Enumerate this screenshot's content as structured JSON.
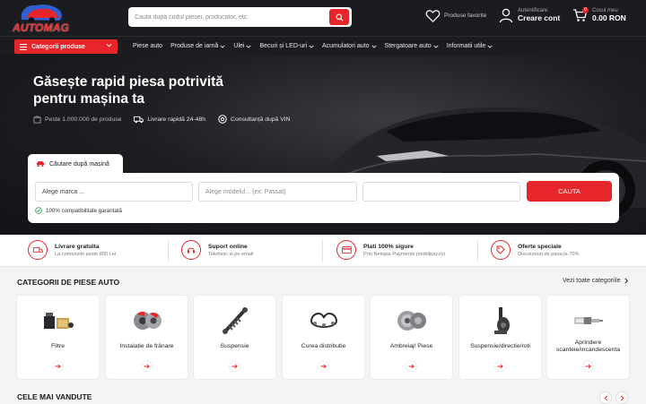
{
  "header": {
    "logo_text": "AUTOMAG",
    "search_placeholder": "Cauta dupa codul piesei, producator, etc.",
    "favorites_label": "Produse favorite",
    "account_small": "Autentificare",
    "account_big": "Creare cont",
    "cart_small": "Cosul meu",
    "cart_total": "0.00 RON",
    "cart_count": "0"
  },
  "nav": {
    "categories_button": "Categorii produse",
    "items": [
      {
        "label": "Piese auto",
        "dropdown": false
      },
      {
        "label": "Produse de iarnă",
        "dropdown": true
      },
      {
        "label": "Ulei",
        "dropdown": true
      },
      {
        "label": "Becuri și LED-uri",
        "dropdown": true
      },
      {
        "label": "Acumulatori auto",
        "dropdown": true
      },
      {
        "label": "Stergatoare auto",
        "dropdown": true
      },
      {
        "label": "Informatii utile",
        "dropdown": true
      }
    ]
  },
  "hero": {
    "title": "Găsește rapid piesa potrivită pentru mașina ta",
    "features": [
      "Peste 1.000.000 de produse",
      "Livrare rapidă 24-48h",
      "Consultanță după VIN"
    ]
  },
  "car_search": {
    "tab_label": "Căutare după mașină",
    "brand_placeholder": "Alege marca ...",
    "model_placeholder": "Alege modelul... (ex: Passat)",
    "third_value": "",
    "submit_label": "CAUTA",
    "compat_text": "100% compatibilitate garantată"
  },
  "perks": [
    {
      "title": "Livrare gratuita",
      "sub": "La comenzile peste 800 Lei",
      "icon": "truck-icon"
    },
    {
      "title": "Suport online",
      "sub": "Telefonic si pe email",
      "icon": "headset-icon"
    },
    {
      "title": "Plati 100% sigure",
      "sub": "Prin Netopia Payments (mobilpay.ro)",
      "icon": "card-icon"
    },
    {
      "title": "Oferte speciale",
      "sub": "Discounturi de pana la 70%",
      "icon": "tag-icon"
    }
  ],
  "categories": {
    "title": "CATEGORII DE PIESE AUTO",
    "see_all": "Vezi toate categoriile",
    "items": [
      {
        "label": "Filtre",
        "icon": "filter-icon"
      },
      {
        "label": "Instalație de frânare",
        "icon": "brake-icon"
      },
      {
        "label": "Suspensie",
        "icon": "shock-absorber-icon"
      },
      {
        "label": "Curea distributie",
        "icon": "timing-belt-icon"
      },
      {
        "label": "Ambreiaj/ Piese",
        "icon": "clutch-icon"
      },
      {
        "label": "Suspensie/directie/roti",
        "icon": "steering-icon"
      },
      {
        "label": "Aprindere scanteie/incandescenta",
        "icon": "spark-plug-icon"
      }
    ]
  },
  "best_sellers": {
    "title": "CELE MAI VANDUTE"
  },
  "colors": {
    "accent": "#e7262b",
    "dark": "#1b1c20"
  }
}
